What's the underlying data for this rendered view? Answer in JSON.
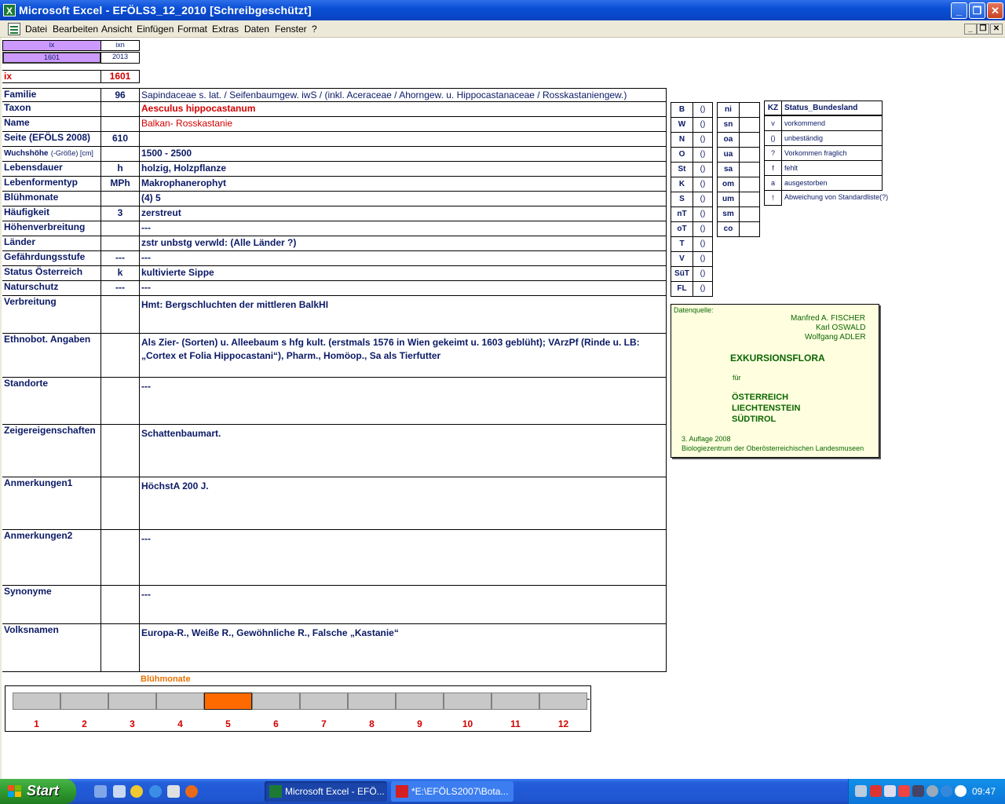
{
  "window": {
    "title": "Microsoft Excel - EFÖLS3_12_2010  [Schreibgeschützt]",
    "minimize": "_",
    "restore": "❐",
    "close": "✕"
  },
  "menu": {
    "items": [
      "Datei",
      "Bearbeiten",
      "Ansicht",
      "Einfügen",
      "Format",
      "Extras",
      "Daten",
      "Fenster",
      "?"
    ]
  },
  "index": {
    "hdr1": "ix",
    "hdr2": "ixn",
    "val1": "1601",
    "val2": "2013",
    "ix_label": "ix",
    "ix_value": "1601"
  },
  "rows": [
    {
      "label": "Familie",
      "mid": "96",
      "value": "Sapindaceae s. lat.  /  Seifenbaumgew. iwS / (inkl. Aceraceae / Ahorngew. u. Hippocastanaceae / Rosskastaniengew.)"
    },
    {
      "label": "Taxon",
      "mid": "",
      "value": "Aesculus hippocastanum"
    },
    {
      "label": "Name",
      "mid": "",
      "value": "Balkan- Rosskastanie"
    },
    {
      "label": "Seite (EFÖLS 2008)",
      "mid": "610",
      "value": ""
    },
    {
      "label": "Wuchshöhe",
      "label_sub": "(-Größe) [cm]",
      "mid": "",
      "value": " 1500 - 2500"
    },
    {
      "label": "Lebensdauer",
      "mid": "h",
      "value": "holzig, Holzpflanze"
    },
    {
      "label": "Lebenformentyp",
      "mid": "MPh",
      "value": "Makrophanerophyt"
    },
    {
      "label": "Blühmonate",
      "mid": "",
      "value": "(4) 5"
    },
    {
      "label": "Häufigkeit",
      "mid": "3",
      "value": "zerstreut"
    },
    {
      "label": "Höhenverbreitung",
      "mid": "",
      "value": " ---"
    },
    {
      "label": "Länder",
      "mid": "",
      "value": "zstr unbstg verwld: (Alle Länder ?)"
    },
    {
      "label": "Gefährdungsstufe",
      "mid": "---",
      "value": "  ---"
    },
    {
      "label": "Status Österreich",
      "mid": "k",
      "value": "kultivierte Sippe"
    },
    {
      "label": "Naturschutz",
      "mid": "---",
      "value": " ---"
    },
    {
      "label": "Verbreitung",
      "mid": "",
      "value": "Hmt: Bergschluchten der mittleren BalkHI"
    },
    {
      "label": "Ethnobot. Angaben",
      "mid": "",
      "value": " Als Zier- (Sorten) u. Alleebaum s hfg kult. (erstmals 1576 in Wien gekeimt u. 1603 geblüht); VArzPf (Rinde u. LB: „Cortex et Folia Hippocastani“), Pharm., Homöop., Sa als Tierfutter"
    },
    {
      "label": "Standorte",
      "mid": "",
      "value": "---"
    },
    {
      "label": "Zeigereigenschaften",
      "mid": "",
      "value": "Schattenbaumart."
    },
    {
      "label": "Anmerkungen1",
      "mid": "",
      "value": "HöchstA 200 J."
    },
    {
      "label": "Anmerkungen2",
      "mid": "",
      "value": "---"
    },
    {
      "label": "Synonyme",
      "mid": "",
      "value": "---"
    },
    {
      "label": "Volksnamen",
      "mid": "",
      "value": "Europa-R., Weiße R., Gewöhnliche R.,   Falsche „Kastanie“"
    }
  ],
  "regions1": [
    {
      "code": "B",
      "val": "()"
    },
    {
      "code": "W",
      "val": "()"
    },
    {
      "code": "N",
      "val": "()"
    },
    {
      "code": "O",
      "val": "()"
    },
    {
      "code": "St",
      "val": "()"
    },
    {
      "code": "K",
      "val": "()"
    },
    {
      "code": "S",
      "val": "()"
    },
    {
      "code": "nT",
      "val": "()"
    },
    {
      "code": "oT",
      "val": "()"
    },
    {
      "code": "T",
      "val": "()"
    },
    {
      "code": "V",
      "val": "()"
    },
    {
      "code": "SüT",
      "val": "()"
    },
    {
      "code": "FL",
      "val": "()"
    }
  ],
  "regions2": [
    {
      "code": "ni",
      "val": ""
    },
    {
      "code": "sn",
      "val": ""
    },
    {
      "code": "oa",
      "val": ""
    },
    {
      "code": "ua",
      "val": ""
    },
    {
      "code": "sa",
      "val": ""
    },
    {
      "code": "om",
      "val": ""
    },
    {
      "code": "um",
      "val": ""
    },
    {
      "code": "sm",
      "val": ""
    },
    {
      "code": "co",
      "val": ""
    }
  ],
  "legend": {
    "kz": "KZ",
    "title": "Status_Bundesland",
    "items": [
      {
        "code": "v",
        "text": "vorkommend"
      },
      {
        "code": "()",
        "text": "unbeständig"
      },
      {
        "code": "?",
        "text": "Vorkommen fraglich"
      },
      {
        "code": "f",
        "text": "fehlt"
      },
      {
        "code": "a",
        "text": "ausgestorben"
      },
      {
        "code": "!",
        "text": "Abweichung von Standardliste(?)"
      }
    ]
  },
  "source": {
    "label": "Datenquelle:",
    "author1": "Manfred A. FISCHER",
    "author2": "Karl OSWALD",
    "author3": "Wolfgang ADLER",
    "title": "EXKURSIONSFLORA",
    "fuer": "für",
    "c1": "ÖSTERREICH",
    "c2": "LIECHTENSTEIN",
    "c3": "SÜDTIROL",
    "edition": "3. Auflage 2008",
    "publisher": "Biologiezentrum der Oberösterreichischen Landesmuseen"
  },
  "bloom": {
    "title": "Blühmonate",
    "months": [
      "1",
      "2",
      "3",
      "4",
      "5",
      "6",
      "7",
      "8",
      "9",
      "10",
      "11",
      "12"
    ],
    "active": [
      5
    ],
    "active_color": "#ff6a00",
    "inactive_color": "#c8c8c8"
  },
  "taskbar": {
    "start": "Start",
    "task1": "Microsoft Excel - EFÖ...",
    "task2": "*E:\\EFÖLS2007\\Bota...",
    "clock": "09:47"
  }
}
